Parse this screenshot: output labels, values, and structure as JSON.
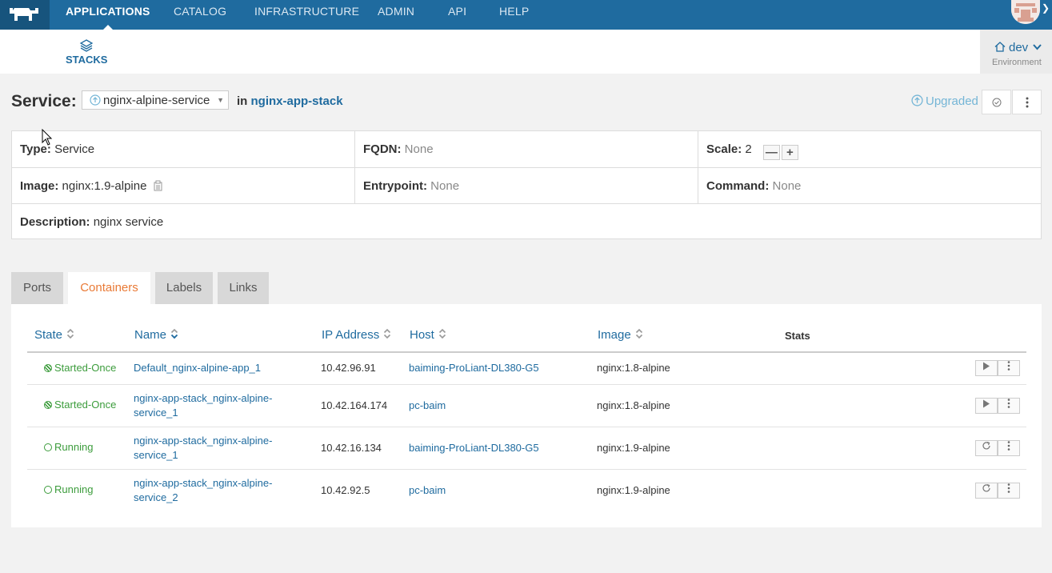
{
  "nav": {
    "items": [
      "APPLICATIONS",
      "CATALOG",
      "INFRASTRUCTURE",
      "ADMIN",
      "API",
      "HELP"
    ],
    "active": "APPLICATIONS"
  },
  "subnav": {
    "stacks_label": "STACKS"
  },
  "environment": {
    "name": "dev",
    "label": "Environment"
  },
  "service": {
    "title": "Service:",
    "selected": "nginx-alpine-service",
    "in_prefix": "in",
    "stack": "nginx-app-stack",
    "status": "Upgraded"
  },
  "info": {
    "type_label": "Type:",
    "type_value": "Service",
    "fqdn_label": "FQDN:",
    "fqdn_value": "None",
    "scale_label": "Scale:",
    "scale_value": "2",
    "image_label": "Image:",
    "image_value": "nginx:1.9-alpine",
    "entrypoint_label": "Entrypoint:",
    "entrypoint_value": "None",
    "command_label": "Command:",
    "command_value": "None",
    "description_label": "Description:",
    "description_value": "nginx service"
  },
  "tabs": [
    "Ports",
    "Containers",
    "Labels",
    "Links"
  ],
  "active_tab": "Containers",
  "table": {
    "headers": {
      "state": "State",
      "name": "Name",
      "ip": "IP Address",
      "host": "Host",
      "image": "Image",
      "stats": "Stats"
    },
    "rows": [
      {
        "state": "Started-Once",
        "name1": "Default_nginx-alpine-app_1",
        "name2": "",
        "ip": "10.42.96.91",
        "host": "baiming-ProLiant-DL380-G5",
        "image": "nginx:1.8-alpine",
        "action": "play"
      },
      {
        "state": "Started-Once",
        "name1": "nginx-app-stack_nginx-alpine-",
        "name2": "service_1",
        "ip": "10.42.164.174",
        "host": "pc-baim",
        "image": "nginx:1.8-alpine",
        "action": "play"
      },
      {
        "state": "Running",
        "name1": "nginx-app-stack_nginx-alpine-",
        "name2": "service_1",
        "ip": "10.42.16.134",
        "host": "baiming-ProLiant-DL380-G5",
        "image": "nginx:1.9-alpine",
        "action": "restart"
      },
      {
        "state": "Running",
        "name1": "nginx-app-stack_nginx-alpine-",
        "name2": "service_2",
        "ip": "10.42.92.5",
        "host": "pc-baim",
        "image": "nginx:1.9-alpine",
        "action": "restart"
      }
    ]
  },
  "colors": {
    "nav_bg": "#1f6b9f",
    "link": "#1f6b9f",
    "running": "#3c9c3c",
    "active_tab": "#e97a36",
    "upgraded": "#74b5d6"
  }
}
